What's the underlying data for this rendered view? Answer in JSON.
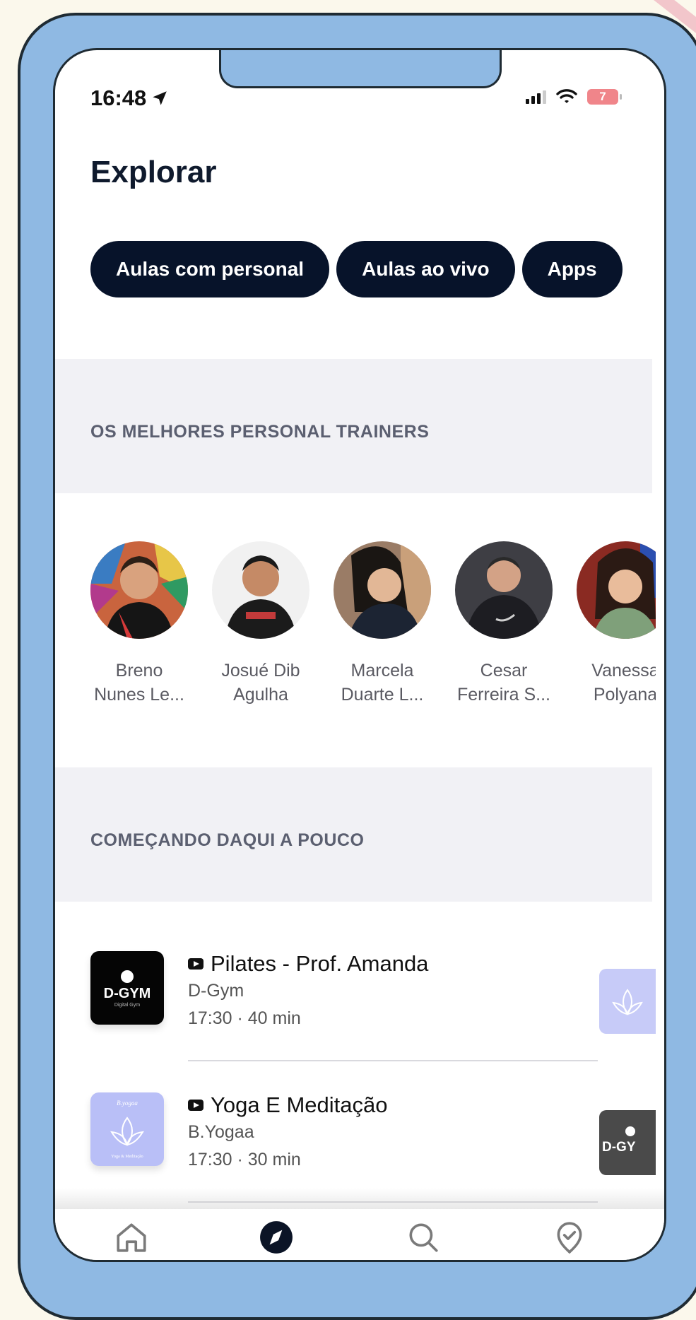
{
  "status_bar": {
    "time": "16:48",
    "battery": "7"
  },
  "page_title": "Explorar",
  "tabs": [
    {
      "label": "Aulas com personal"
    },
    {
      "label": "Aulas ao vivo"
    },
    {
      "label": "Apps"
    }
  ],
  "sections": {
    "trainers_title": "OS MELHORES PERSONAL TRAINERS",
    "upcoming_title": "COMEÇANDO DAQUI A POUCO"
  },
  "trainers": [
    {
      "name": "Breno\nNunes Le..."
    },
    {
      "name": "Josué Dib\nAgulha"
    },
    {
      "name": "Marcela\nDuarte L..."
    },
    {
      "name": "Cesar\nFerreira S..."
    },
    {
      "name": "Vanessa\nPolyana"
    }
  ],
  "classes": [
    {
      "title": "Pilates - Prof. Amanda",
      "provider": "D-Gym",
      "time": "17:30 · 40 min",
      "logo_text": "D-GYM",
      "logo_sub": "Digital Gym"
    },
    {
      "title": "Yoga E Meditação",
      "provider": "B.Yogaa",
      "time": "17:30 · 30 min",
      "logo_text": "B.yogaa",
      "logo_sub": "Yoga & Meditação"
    }
  ],
  "tabbar": [
    {
      "icon": "home-icon"
    },
    {
      "icon": "compass-icon"
    },
    {
      "icon": "search-icon"
    },
    {
      "icon": "check-badge-icon"
    }
  ],
  "colors": {
    "frame": "#8fb9e3",
    "tab_bg": "#07132a",
    "section_bg": "#f1f1f5",
    "accent_purple": "#b9bff7"
  }
}
